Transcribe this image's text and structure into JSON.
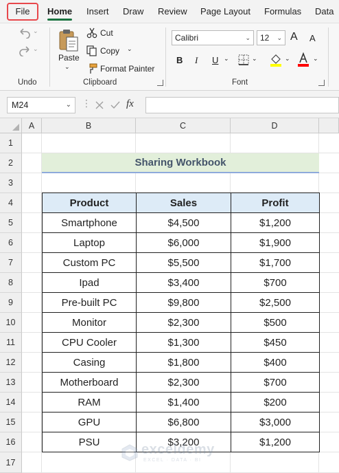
{
  "menu": {
    "tabs": [
      "File",
      "Home",
      "Insert",
      "Draw",
      "Review",
      "Page Layout",
      "Formulas",
      "Data"
    ],
    "active": "Home"
  },
  "ribbon": {
    "undo_label": "Undo",
    "paste_label": "Paste",
    "cut_label": "Cut",
    "copy_label": "Copy",
    "format_painter_label": "Format Painter",
    "clipboard_label": "Clipboard",
    "font_name": "Calibri",
    "font_size": "12",
    "font_label": "Font",
    "bold": "B",
    "italic": "I",
    "underline": "U",
    "grow_font": "A",
    "shrink_font": "A",
    "fill_color": "#ffff00",
    "font_color": "#ff0000"
  },
  "formula_bar": {
    "name_box": "M24",
    "fx_label": "fx",
    "formula": ""
  },
  "grid": {
    "columns": [
      "A",
      "B",
      "C",
      "D"
    ],
    "rows": [
      "1",
      "2",
      "3",
      "4",
      "5",
      "6",
      "7",
      "8",
      "9",
      "10",
      "11",
      "12",
      "13",
      "14",
      "15",
      "16",
      "17"
    ]
  },
  "sheet": {
    "title": "Sharing Workbook",
    "headers": [
      "Product",
      "Sales",
      "Profit"
    ],
    "rows": [
      [
        "Smartphone",
        "$4,500",
        "$1,200"
      ],
      [
        "Laptop",
        "$6,000",
        "$1,900"
      ],
      [
        "Custom PC",
        "$5,500",
        "$1,700"
      ],
      [
        "Ipad",
        "$3,400",
        "$700"
      ],
      [
        "Pre-built PC",
        "$9,800",
        "$2,500"
      ],
      [
        "Monitor",
        "$2,300",
        "$500"
      ],
      [
        "CPU Cooler",
        "$1,300",
        "$450"
      ],
      [
        "Casing",
        "$1,800",
        "$400"
      ],
      [
        "Motherboard",
        "$2,300",
        "$700"
      ],
      [
        "RAM",
        "$1,400",
        "$200"
      ],
      [
        "GPU",
        "$6,800",
        "$3,000"
      ],
      [
        "PSU",
        "$3,200",
        "$1,200"
      ]
    ]
  },
  "watermark": {
    "name": "exceldemy",
    "tagline": "EXCEL · DATA · BI"
  }
}
